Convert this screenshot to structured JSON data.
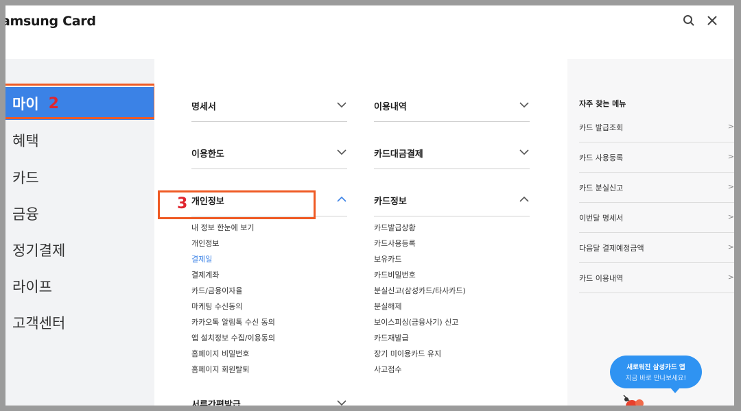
{
  "header": {
    "logo": "amsung Card",
    "icons": [
      "search-icon",
      "close-icon"
    ]
  },
  "sidebar": {
    "items": [
      {
        "label": "마이",
        "step": "2"
      },
      {
        "label": "혜택"
      },
      {
        "label": "카드"
      },
      {
        "label": "금융"
      },
      {
        "label": "정기결제"
      },
      {
        "label": "라이프"
      },
      {
        "label": "고객센터"
      }
    ]
  },
  "menu": {
    "col1": {
      "sec1": "명세서",
      "sec2": "이용한도",
      "sec3": "개인정보",
      "sub": [
        "내 정보 한눈에 보기",
        "개인정보",
        "결제일",
        "결제계좌",
        "카드/금융이자율",
        "마케팅 수신동의",
        "카카오톡 알림톡 수신 동의",
        "앱 설치정보 수집/이용동의",
        "홈페이지 비밀번호",
        "홈페이지 회원탈퇴"
      ],
      "sec4": "서류간편발급"
    },
    "col2": {
      "sec1": "이용내역",
      "sec2": "카드대금결제",
      "sec3": "카드정보",
      "sub": [
        "카드발급상황",
        "카드사용등록",
        "보유카드",
        "카드비밀번호",
        "분실신고(삼성카드/타사카드)",
        "분실해제",
        "보이스피싱(금융사기) 신고",
        "카드재발급",
        "장기 미이용카드 유지",
        "사고접수"
      ]
    },
    "step3": "3"
  },
  "favorites": {
    "title": "자주 찾는 메뉴",
    "items": [
      "카드 발급조회",
      "카드 사용등록",
      "카드 분실신고",
      "이번달 명세서",
      "다음달 결제예정금액",
      "카드 이용내역"
    ],
    "arrow": ">"
  },
  "promo": {
    "line1": "새로워진 삼성카드 앱",
    "line2": "지금 바로 만나보세요!"
  },
  "colors": {
    "accent": "#3b82e6",
    "highlight": "#ef5a24",
    "step": "#e0262f"
  }
}
